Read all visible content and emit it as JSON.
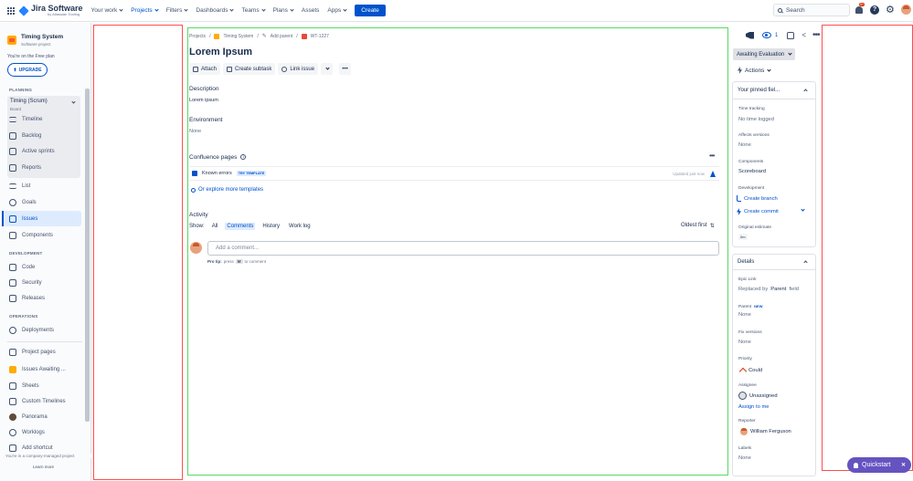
{
  "topnav": {
    "brand": "Jira Software",
    "brand_sub": "by Atlassian Tooling",
    "items": [
      "Your work",
      "Projects",
      "Filters",
      "Dashboards",
      "Teams",
      "Plans",
      "Assets",
      "Apps"
    ],
    "create": "Create",
    "search_placeholder": "Search",
    "notif_badge": "9+",
    "help": "?"
  },
  "sidebar": {
    "project_name": "Timing System",
    "project_type": "Software project",
    "plan_text": "You're on the Free plan",
    "upgrade": "UPGRADE",
    "planning_title": "PLANNING",
    "board_title": "Timing (Scrum)",
    "board_sub": "Board",
    "board_items": [
      "Timeline",
      "Backlog",
      "Active sprints",
      "Reports"
    ],
    "items": [
      "List",
      "Goals",
      "Issues",
      "Components"
    ],
    "development_title": "DEVELOPMENT",
    "dev_items": [
      "Code",
      "Security",
      "Releases"
    ],
    "operations_title": "OPERATIONS",
    "ops_items": [
      "Deployments"
    ],
    "extra_items": [
      "Project pages",
      "Issues Awaiting ...",
      "Sheets",
      "Custom Timelines",
      "Panorama",
      "Worklogs",
      "Add shortcut"
    ],
    "footer": "You're in a company-managed project",
    "learn_more": "Learn more"
  },
  "main": {
    "breadcrumb": {
      "projects": "Projects",
      "project": "Timing System",
      "add_parent": "Add parent",
      "issue_key": "WT-1227"
    },
    "title": "Lorem Ipsum",
    "toolbar": {
      "attach": "Attach",
      "create_subtask": "Create subtask",
      "link_issue": "Link issue"
    },
    "description_label": "Description",
    "description_value": "Lorem ipsum",
    "environment_label": "Environment",
    "environment_value": "None",
    "confluence_label": "Confluence pages",
    "confluence_item": "Known errors",
    "confluence_badge": "TRY TEMPLATE",
    "confluence_updated": "Updated just now",
    "explore_link": "Or explore more templates",
    "activity_label": "Activity",
    "show_label": "Show:",
    "activity_tabs": [
      "All",
      "Comments",
      "History",
      "Work log"
    ],
    "sort_label": "Oldest first",
    "comment_placeholder": "Add a comment...",
    "protip_bold": "Pro tip:",
    "protip_press": "press",
    "protip_key": "M",
    "protip_rest": "to comment"
  },
  "right_panel": {
    "watchers_count": "1",
    "status": "Awaiting Evaluation",
    "actions": "Actions",
    "pinned_title": "Your pinned fiel...",
    "fields_a": [
      {
        "label": "Time tracking",
        "value": "No time logged"
      },
      {
        "label": "Affects versions",
        "value": "None"
      },
      {
        "label": "Components",
        "value": "Scoreboard"
      },
      {
        "label": "Development",
        "value": ""
      },
      {
        "label": "Original estimate",
        "value": "0m"
      }
    ],
    "create_branch": "Create branch",
    "create_commit": "Create commit",
    "details_title": "Details",
    "epic_link_label": "Epic Link",
    "epic_link_replaced": "Replaced by",
    "epic_link_parent": "Parent",
    "epic_link_field": "field",
    "parent_label": "Parent",
    "parent_new": "NEW",
    "parent_value": "None",
    "fix_label": "Fix versions",
    "fix_value": "None",
    "priority_label": "Priority",
    "priority_value": "Could",
    "assignee_label": "Assignee",
    "assignee_value": "Unassigned",
    "assign_to_me": "Assign to me",
    "reporter_label": "Reporter",
    "reporter_value": "William Ferguson",
    "labels_label": "Labels",
    "labels_value": "None"
  },
  "quickstart": {
    "label": "Quickstart",
    "close": "✕"
  },
  "colors": {
    "accent": "#0052cc",
    "quickstart": "#6554c0",
    "annotation_red": "#ff4d4d",
    "annotation_green": "#57d961"
  }
}
